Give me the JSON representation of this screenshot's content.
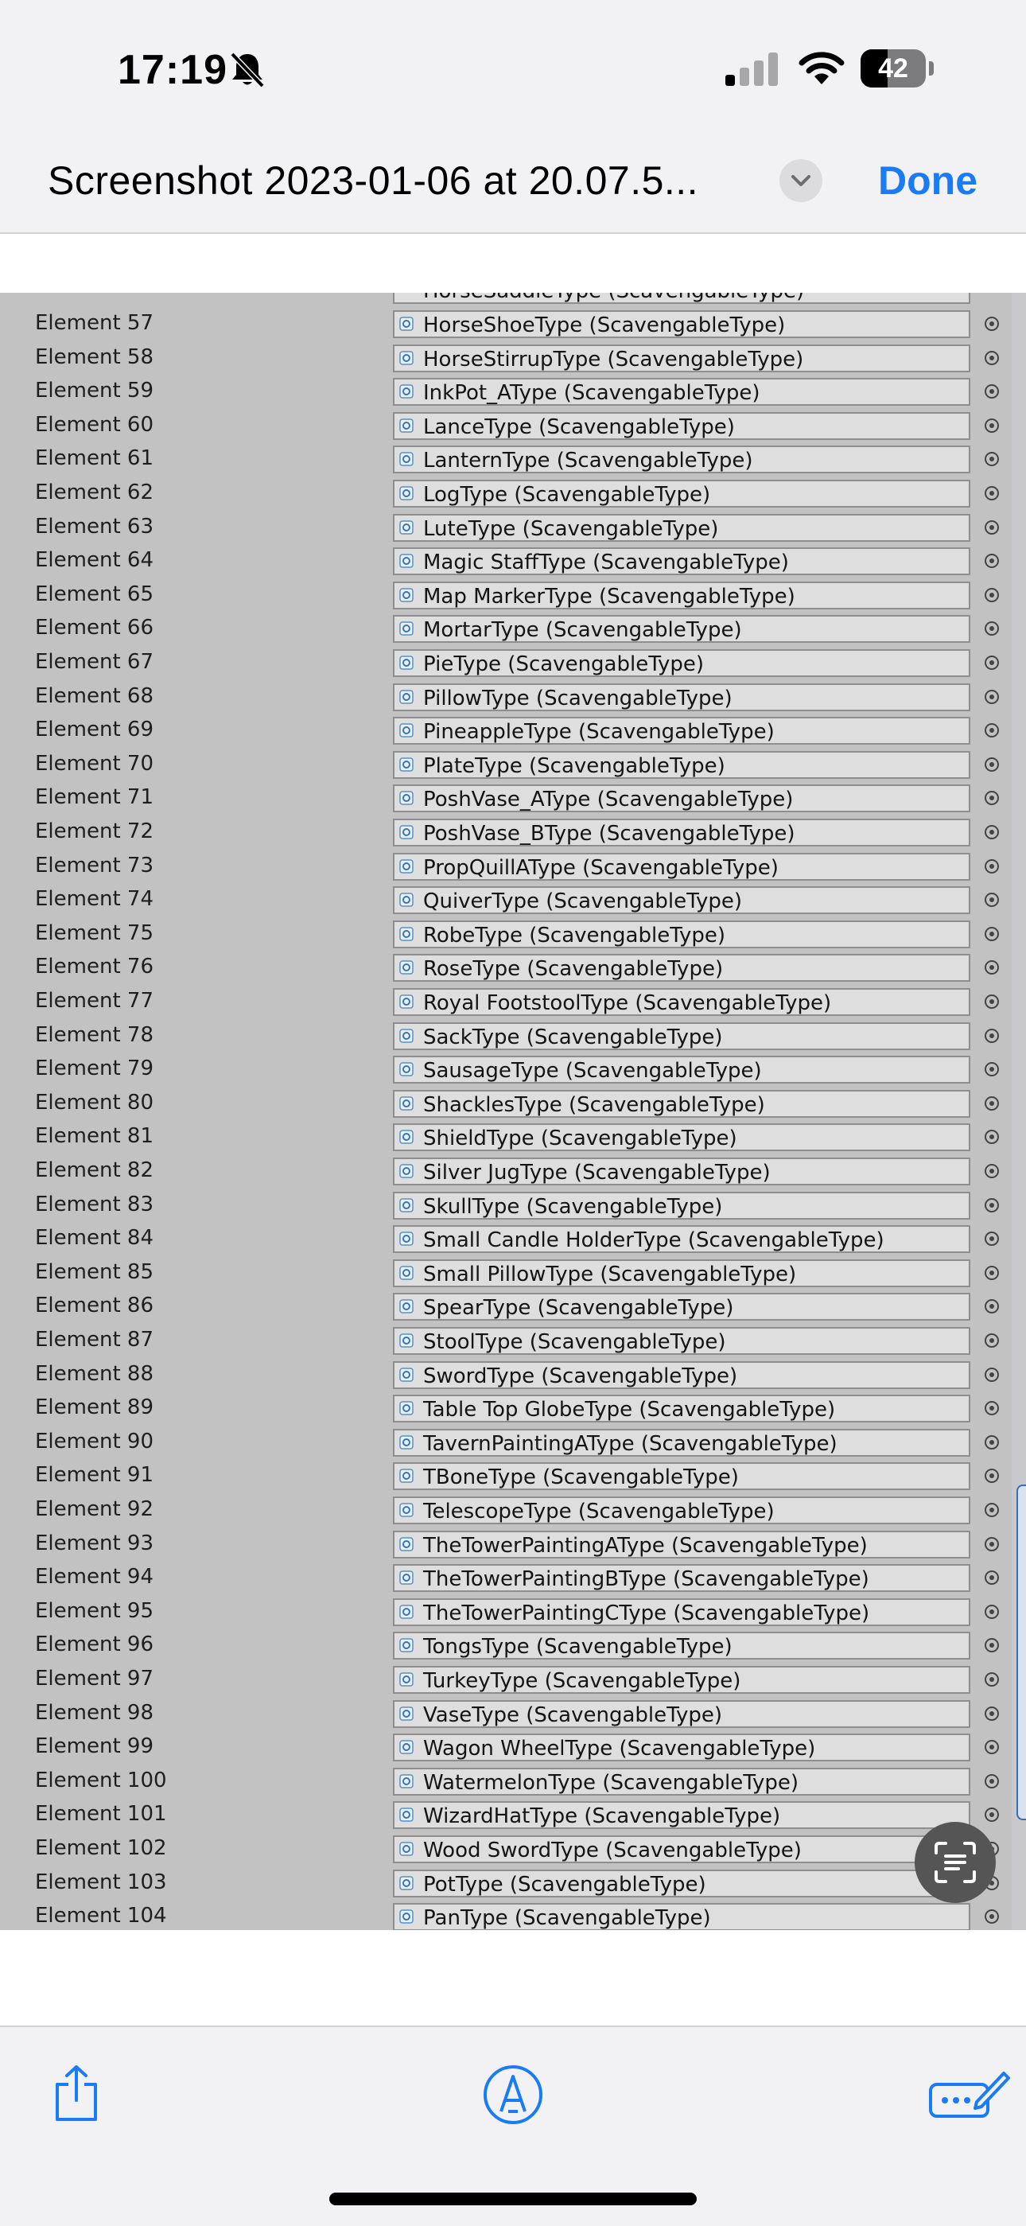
{
  "status_bar": {
    "time": "17:19",
    "battery": "42",
    "battery_level": 0.42
  },
  "header": {
    "title": "Screenshot 2023-01-06 at 20.07.5...",
    "done_label": "Done"
  },
  "inspector": {
    "partial_top_text": "HorseSaddleType (ScavengableType)",
    "rows": [
      {
        "label": "Element 57",
        "value": "HorseShoeType (ScavengableType)"
      },
      {
        "label": "Element 58",
        "value": "HorseStirrupType (ScavengableType)"
      },
      {
        "label": "Element 59",
        "value": "InkPot_AType (ScavengableType)"
      },
      {
        "label": "Element 60",
        "value": "LanceType (ScavengableType)"
      },
      {
        "label": "Element 61",
        "value": "LanternType (ScavengableType)"
      },
      {
        "label": "Element 62",
        "value": "LogType (ScavengableType)"
      },
      {
        "label": "Element 63",
        "value": "LuteType (ScavengableType)"
      },
      {
        "label": "Element 64",
        "value": "Magic StaffType (ScavengableType)"
      },
      {
        "label": "Element 65",
        "value": "Map MarkerType (ScavengableType)"
      },
      {
        "label": "Element 66",
        "value": "MortarType (ScavengableType)"
      },
      {
        "label": "Element 67",
        "value": "PieType (ScavengableType)"
      },
      {
        "label": "Element 68",
        "value": "PillowType (ScavengableType)"
      },
      {
        "label": "Element 69",
        "value": "PineappleType (ScavengableType)"
      },
      {
        "label": "Element 70",
        "value": "PlateType (ScavengableType)"
      },
      {
        "label": "Element 71",
        "value": "PoshVase_AType (ScavengableType)"
      },
      {
        "label": "Element 72",
        "value": "PoshVase_BType (ScavengableType)"
      },
      {
        "label": "Element 73",
        "value": "PropQuillAType (ScavengableType)"
      },
      {
        "label": "Element 74",
        "value": "QuiverType (ScavengableType)"
      },
      {
        "label": "Element 75",
        "value": "RobeType (ScavengableType)"
      },
      {
        "label": "Element 76",
        "value": "RoseType (ScavengableType)"
      },
      {
        "label": "Element 77",
        "value": "Royal FootstoolType (ScavengableType)"
      },
      {
        "label": "Element 78",
        "value": "SackType (ScavengableType)"
      },
      {
        "label": "Element 79",
        "value": "SausageType (ScavengableType)"
      },
      {
        "label": "Element 80",
        "value": "ShacklesType (ScavengableType)"
      },
      {
        "label": "Element 81",
        "value": "ShieldType (ScavengableType)"
      },
      {
        "label": "Element 82",
        "value": "Silver JugType (ScavengableType)"
      },
      {
        "label": "Element 83",
        "value": "SkullType (ScavengableType)"
      },
      {
        "label": "Element 84",
        "value": "Small Candle HolderType (ScavengableType)"
      },
      {
        "label": "Element 85",
        "value": "Small PillowType (ScavengableType)"
      },
      {
        "label": "Element 86",
        "value": "SpearType (ScavengableType)"
      },
      {
        "label": "Element 87",
        "value": "StoolType (ScavengableType)"
      },
      {
        "label": "Element 88",
        "value": "SwordType (ScavengableType)"
      },
      {
        "label": "Element 89",
        "value": "Table Top GlobeType (ScavengableType)"
      },
      {
        "label": "Element 90",
        "value": "TavernPaintingAType (ScavengableType)"
      },
      {
        "label": "Element 91",
        "value": "TBoneType (ScavengableType)"
      },
      {
        "label": "Element 92",
        "value": "TelescopeType (ScavengableType)"
      },
      {
        "label": "Element 93",
        "value": "TheTowerPaintingAType (ScavengableType)"
      },
      {
        "label": "Element 94",
        "value": "TheTowerPaintingBType (ScavengableType)"
      },
      {
        "label": "Element 95",
        "value": "TheTowerPaintingCType (ScavengableType)"
      },
      {
        "label": "Element 96",
        "value": "TongsType (ScavengableType)"
      },
      {
        "label": "Element 97",
        "value": "TurkeyType (ScavengableType)"
      },
      {
        "label": "Element 98",
        "value": "VaseType (ScavengableType)"
      },
      {
        "label": "Element 99",
        "value": "Wagon WheelType (ScavengableType)"
      },
      {
        "label": "Element 100",
        "value": "WatermelonType (ScavengableType)"
      },
      {
        "label": "Element 101",
        "value": "WizardHatType (ScavengableType)"
      },
      {
        "label": "Element 102",
        "value": "Wood SwordType (ScavengableType)"
      },
      {
        "label": "Element 103",
        "value": "PotType (ScavengableType)"
      },
      {
        "label": "Element 104",
        "value": "PanType (ScavengableType)"
      }
    ]
  },
  "colors": {
    "accent": "#1a7cf5",
    "inspector_bg": "#c2c2c2",
    "field_bg": "#dedede"
  },
  "icons": {
    "status": [
      "bell-slash-icon",
      "cellular-signal-icon",
      "wifi-icon",
      "battery-icon"
    ],
    "header": [
      "chevron-down-icon"
    ],
    "toolbar": [
      "share-icon",
      "markup-icon",
      "edit-icon"
    ],
    "overlay": [
      "live-text-icon"
    ]
  }
}
